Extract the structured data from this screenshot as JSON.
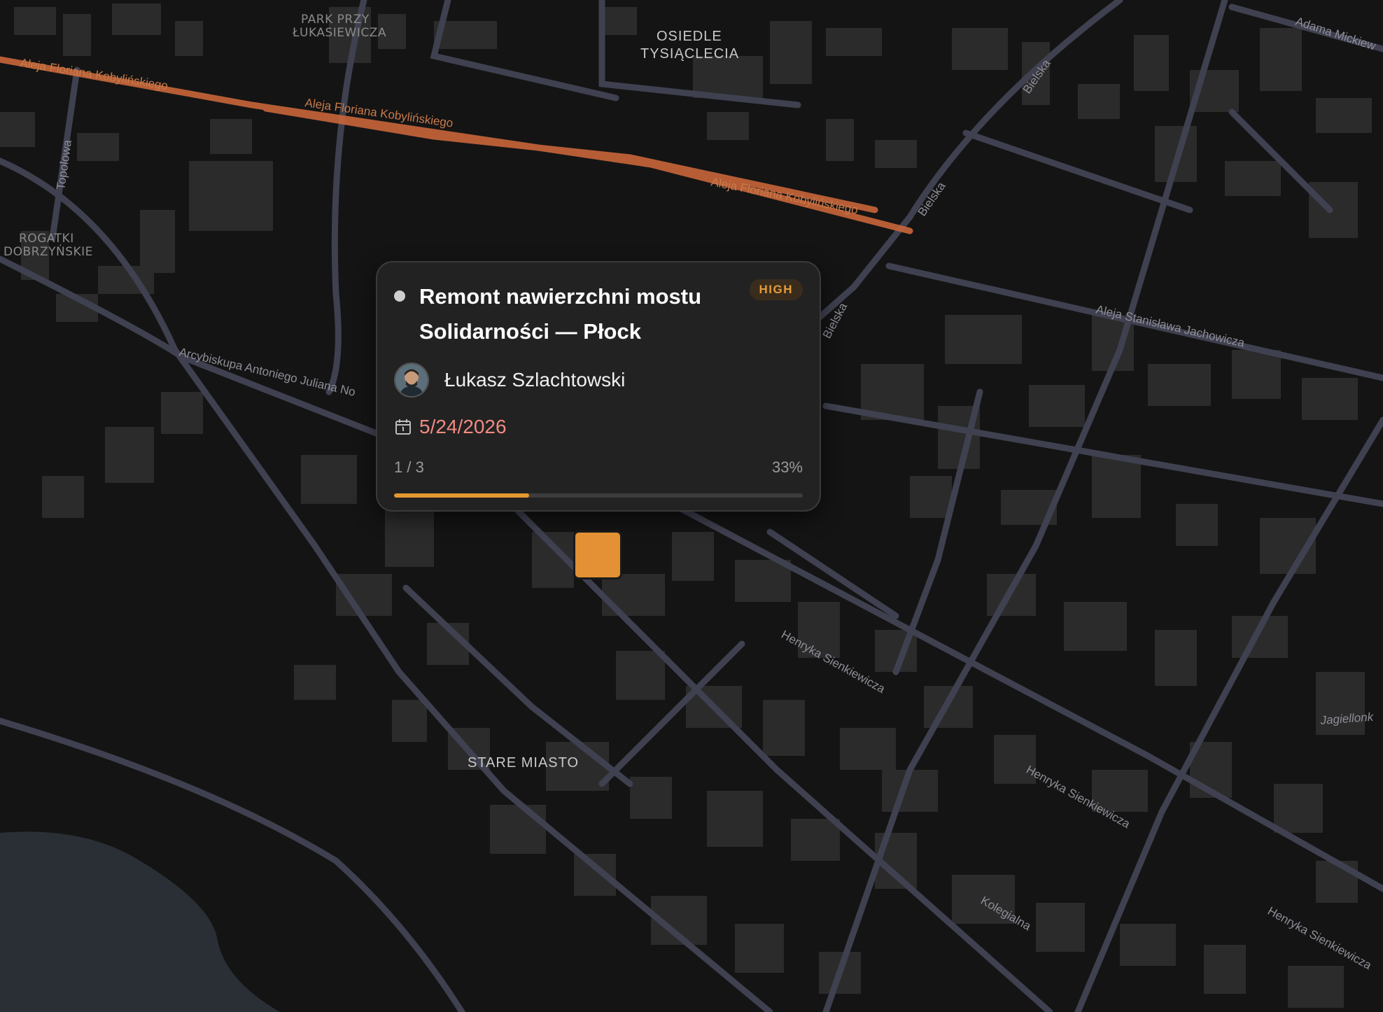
{
  "map": {
    "district_labels": [
      "OSIEDLE",
      "TYSIĄCLECIA",
      "STARE MIASTO"
    ],
    "area_labels": [
      "PARK PRZY",
      "ŁUKASIEWICZA",
      "ROGATKI",
      "DOBRZYŃSKIE"
    ],
    "street_labels": [
      "Aleja Floriana Kobylińskiego",
      "Aleja Floriana Kobylińskiego",
      "Aleja Floriana Kobylińskiego",
      "Topolowa",
      "Bielska",
      "Bielska",
      "Bielska",
      "Adama Mickiew",
      "Aleja Stanisława Jachowicza",
      "Arcybiskupa Antoniego Juliana No",
      "Henryka Sienkiewicza",
      "Henryka Sienkiewicza",
      "Henryka Sienkiewicza",
      "Kolegialna",
      "Jagiellonk"
    ],
    "colors": {
      "background": "#121212",
      "building": "#2b2b2b",
      "road": "#3f4150",
      "highlighted_road": "#c8663a",
      "water": "#2a2f36"
    }
  },
  "popup": {
    "title": "Remont nawierzchni mostu Solidarności — Płock",
    "priority": "HIGH",
    "assignee": "Łukasz Szlachtowski",
    "avatar_icon": "user-avatar",
    "calendar_icon": "calendar-icon",
    "due_date": "5/24/2026",
    "progress_count": "1 / 3",
    "progress_percent": "33%",
    "progress_value": 0.33,
    "colors": {
      "card": "#222222",
      "priority_text": "#e59b3a",
      "priority_bg": "#3a2c1c",
      "due_date": "#f28b82",
      "progress": "#e5972f"
    }
  },
  "marker": {
    "color": "#e39134"
  }
}
